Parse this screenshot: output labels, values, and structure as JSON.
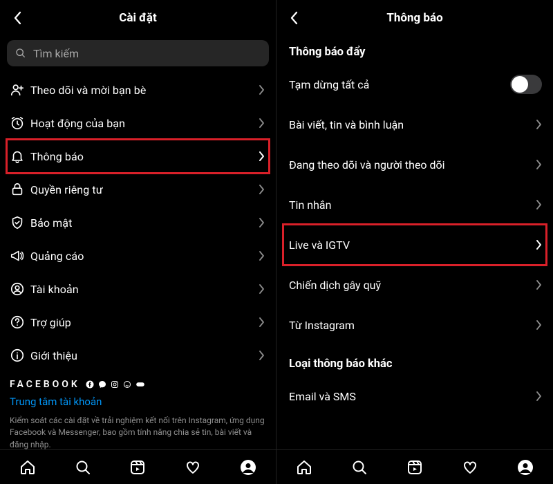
{
  "left": {
    "header": {
      "title": "Cài đặt"
    },
    "search": {
      "placeholder": "Tìm kiếm"
    },
    "items": [
      {
        "icon": "add-friend",
        "label": "Theo dõi và mời bạn bè"
      },
      {
        "icon": "clock",
        "label": "Hoạt động của bạn"
      },
      {
        "icon": "bell",
        "label": "Thông báo",
        "highlight": true
      },
      {
        "icon": "lock",
        "label": "Quyền riêng tư"
      },
      {
        "icon": "shield",
        "label": "Bảo mật"
      },
      {
        "icon": "megaphone",
        "label": "Quảng cáo"
      },
      {
        "icon": "person",
        "label": "Tài khoản"
      },
      {
        "icon": "help",
        "label": "Trợ giúp"
      },
      {
        "icon": "info",
        "label": "Giới thiệu"
      }
    ],
    "brand": {
      "text": "FACEBOOK"
    },
    "account_center": "Trung tâm tài khoản",
    "description": "Kiểm soát các cài đặt về trải nghiệm kết nối trên Instagram, ứng dụng Facebook và Messenger, bao gồm tính năng chia sẻ tin, bài viết và đăng nhập."
  },
  "right": {
    "header": {
      "title": "Thông báo"
    },
    "section_push": "Thông báo đẩy",
    "pause_all": "Tạm dừng tất cả",
    "items": [
      {
        "label": "Bài viết, tin và bình luận"
      },
      {
        "label": "Đang theo dõi và người theo dõi"
      },
      {
        "label": "Tin nhắn"
      },
      {
        "label": "Live và IGTV",
        "highlight": true
      },
      {
        "label": "Chiến dịch gây quỹ"
      },
      {
        "label": "Từ Instagram"
      }
    ],
    "section_other": "Loại thông báo khác",
    "other_items": [
      {
        "label": "Email và SMS"
      }
    ]
  }
}
